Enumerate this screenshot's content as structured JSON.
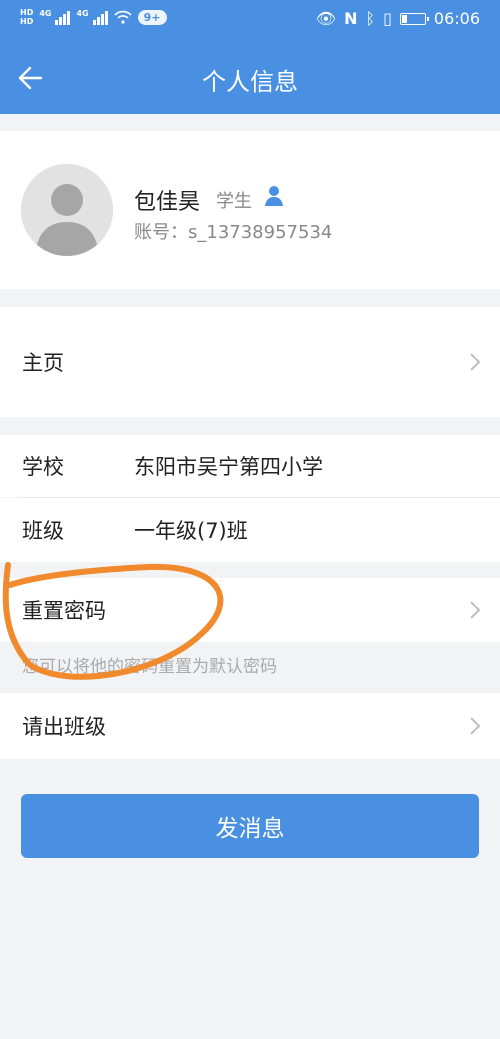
{
  "status_bar": {
    "hd_top": "HD",
    "hd_bottom": "HD",
    "net1": "4G",
    "net2": "4G",
    "notification_count": "9+",
    "time": "06:06"
  },
  "header": {
    "title": "个人信息"
  },
  "profile": {
    "name": "包佳昊",
    "role": "学生",
    "account": "账号：s_13738957534"
  },
  "rows": {
    "home": "主页",
    "school_label": "学校",
    "school_value": "东阳市吴宁第四小学",
    "class_label": "班级",
    "class_value": "一年级(7)班",
    "reset_password": "重置密码",
    "reset_hint": "您可以将他的密码重置为默认密码",
    "leave_class": "请出班级"
  },
  "send_button": "发消息",
  "colors": {
    "primary": "#4a90e2",
    "annotation": "#f08a2c"
  }
}
